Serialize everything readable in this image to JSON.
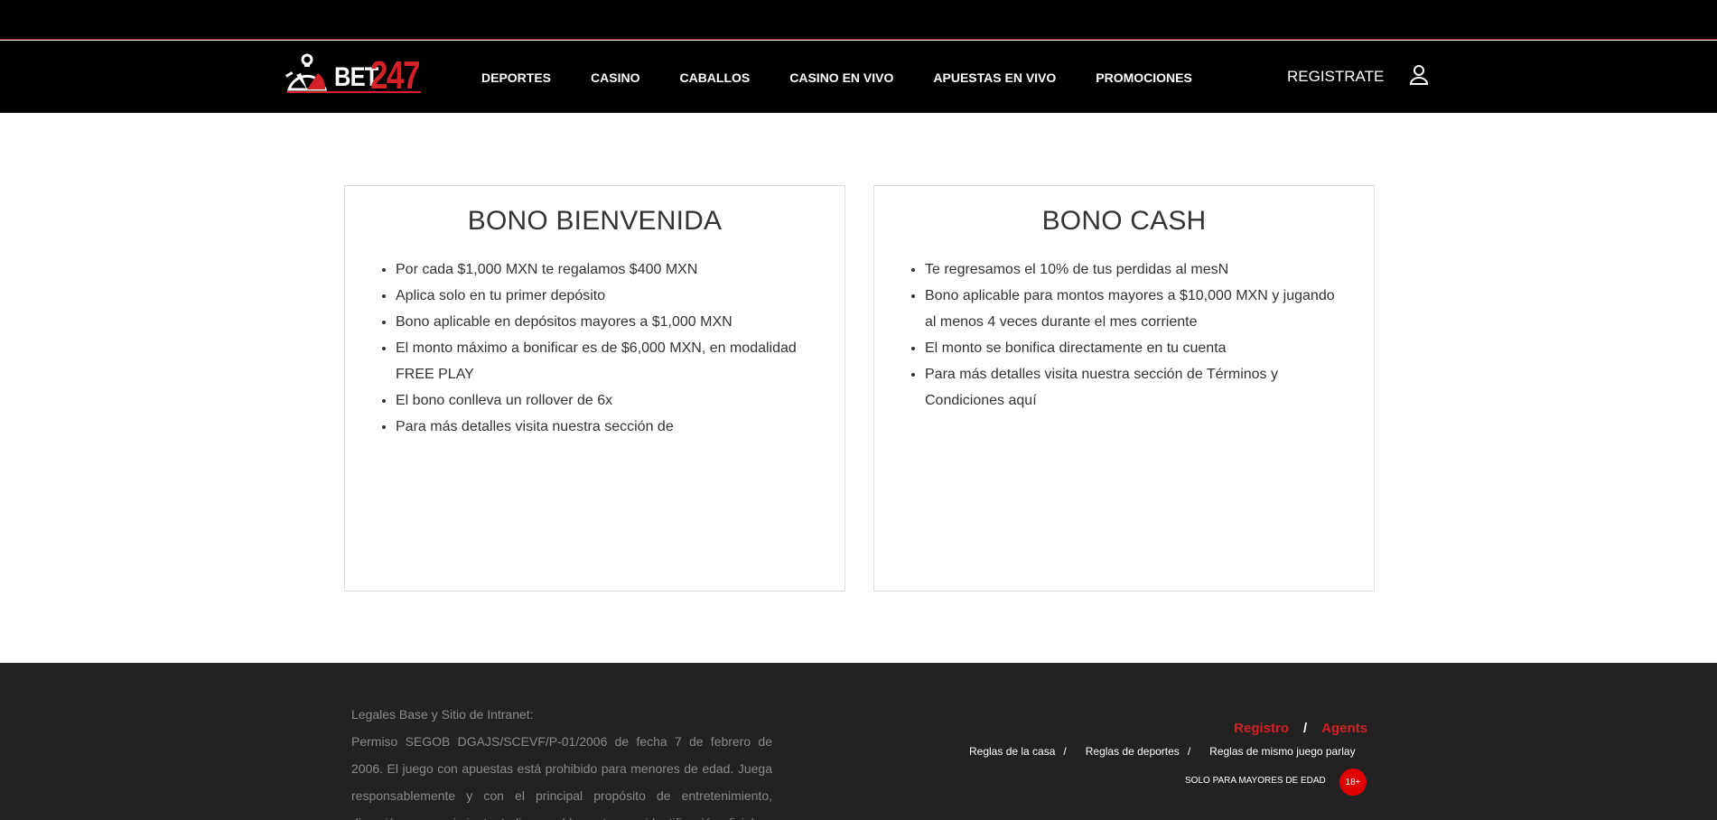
{
  "brand": {
    "name_part1": "BET",
    "name_part2": "247",
    "accent_color": "#d42027"
  },
  "nav": {
    "items": [
      {
        "label": "DEPORTES"
      },
      {
        "label": "CASINO"
      },
      {
        "label": "CABALLOS"
      },
      {
        "label": "CASINO EN VIVO"
      },
      {
        "label": "APUESTAS EN VIVO"
      },
      {
        "label": "PROMOCIONES"
      }
    ],
    "register_label": "REGISTRATE",
    "user_icon": "user-icon"
  },
  "cards": [
    {
      "title": "BONO BIENVENIDA",
      "items": [
        "Por cada $1,000 MXN te regalamos $400 MXN",
        "Aplica solo en tu primer depósito",
        "Bono aplicable en depósitos mayores a $1,000 MXN",
        "El monto máximo a bonificar es de $6,000 MXN, en modalidad FREE PLAY",
        "El bono conlleva un rollover de 6x",
        "Para más detalles visita nuestra sección de"
      ]
    },
    {
      "title": "BONO CASH",
      "items": [
        "Te regresamos el 10% de tus perdidas al mesN",
        "Bono aplicable para montos mayores a $10,000 MXN y jugando al menos 4 veces durante el mes corriente",
        "El monto se bonifica directamente en tu cuenta",
        "Para más detalles visita nuestra sección de Términos y Condiciones aquí"
      ]
    }
  ],
  "footer": {
    "legal_title": "Legales Base y Sitio de Intranet:",
    "legal_text": "Permiso SEGOB DGAJS/SCEVF/P-01/2006 de fecha 7 de febrero de 2006. El juego con apuestas está prohibido para menores de edad. Juega responsablemente y con el principal propósito de entretenimiento, diversión y esparcimiento. Indispensable contar con identificación oficial",
    "registro_label": "Registro",
    "agents_label": "Agents",
    "separator": "/",
    "rules": [
      {
        "label": "Reglas de la casa"
      },
      {
        "label": "Reglas de deportes"
      },
      {
        "label": "Reglas de mismo juego parlay"
      }
    ],
    "age_text": "SOLO PARA MAYORES DE EDAD",
    "age_badge": "18+"
  }
}
